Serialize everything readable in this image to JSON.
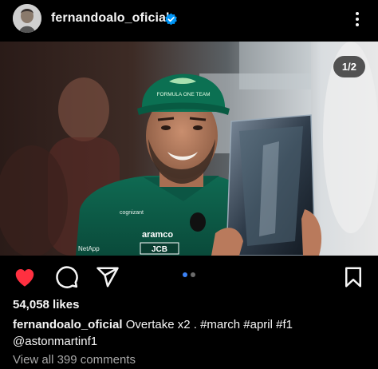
{
  "post": {
    "username": "fernandoalo_oficial",
    "image_counter": "1/2",
    "likes": "54,058 likes",
    "caption_user": "fernandoalo_oficial",
    "caption_text": "Overtake x2 . #march #april #f1 @astonmartinf1",
    "view_comments": "View all 399 comments"
  },
  "photo": {
    "cap_brand": "FORMULA ONE TEAM",
    "shirt_sponsor_1": "aramco",
    "shirt_sponsor_2": "JCB",
    "shirt_sponsor_3": "cognizant",
    "shirt_sponsor_4": "NetApp"
  },
  "icons": {
    "verified": "verified-badge-icon",
    "more": "more-options-icon",
    "like": "heart-icon",
    "comment": "comment-icon",
    "share": "share-icon",
    "save": "bookmark-icon"
  },
  "carousel": {
    "current": 1,
    "total": 2
  },
  "colors": {
    "background": "#000000",
    "like_active": "#ff3040",
    "verified": "#0095f6",
    "dot_active": "#3b82f6",
    "muted_text": "#a8a8a8"
  }
}
